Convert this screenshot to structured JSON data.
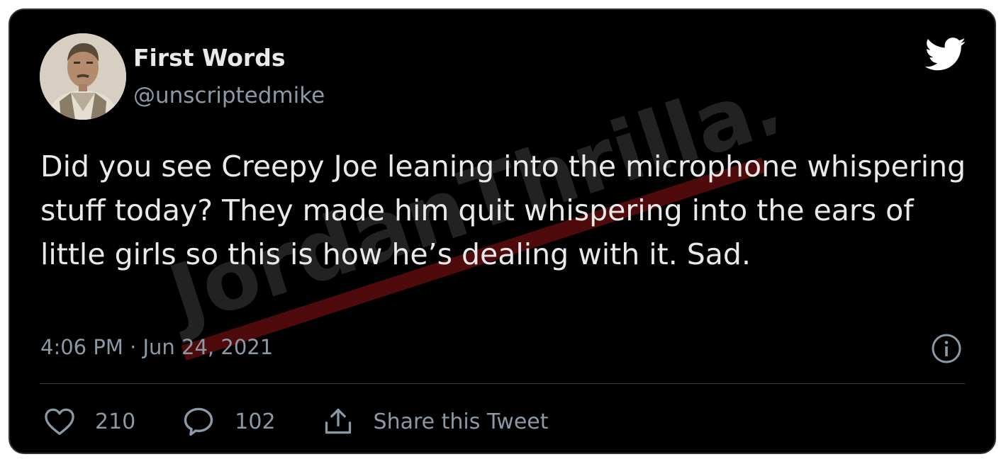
{
  "tweet": {
    "display_name": "First Words",
    "handle": "@unscriptedmike",
    "text": "Did you see Creepy Joe leaning into the microphone whispering stuff today? They made him quit whispering into the ears of little girls so this is how he’s dealing with it. Sad.",
    "timestamp": "4:06 PM · Jun 24, 2021"
  },
  "actions": {
    "likes": "210",
    "replies": "102",
    "share_label": "Share this Tweet"
  },
  "watermark": {
    "text": "JordanThrilla."
  },
  "colors": {
    "background": "#000000",
    "text": "#e7e9ea",
    "secondary": "#8b98a5",
    "watermark_red": "#b01818"
  },
  "icons": [
    "twitter-bird-icon",
    "info-icon",
    "heart-icon",
    "reply-icon",
    "share-icon"
  ]
}
